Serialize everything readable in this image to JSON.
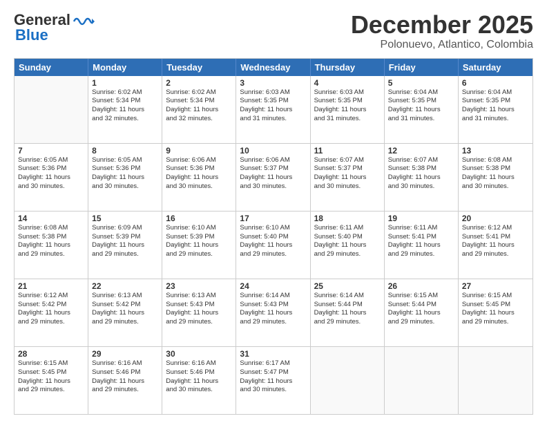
{
  "logo": {
    "line1": "General",
    "line2": "Blue"
  },
  "title": "December 2025",
  "subtitle": "Polonuevo, Atlantico, Colombia",
  "weekdays": [
    "Sunday",
    "Monday",
    "Tuesday",
    "Wednesday",
    "Thursday",
    "Friday",
    "Saturday"
  ],
  "rows": [
    [
      {
        "day": "",
        "info": ""
      },
      {
        "day": "1",
        "info": "Sunrise: 6:02 AM\nSunset: 5:34 PM\nDaylight: 11 hours\nand 32 minutes."
      },
      {
        "day": "2",
        "info": "Sunrise: 6:02 AM\nSunset: 5:34 PM\nDaylight: 11 hours\nand 32 minutes."
      },
      {
        "day": "3",
        "info": "Sunrise: 6:03 AM\nSunset: 5:35 PM\nDaylight: 11 hours\nand 31 minutes."
      },
      {
        "day": "4",
        "info": "Sunrise: 6:03 AM\nSunset: 5:35 PM\nDaylight: 11 hours\nand 31 minutes."
      },
      {
        "day": "5",
        "info": "Sunrise: 6:04 AM\nSunset: 5:35 PM\nDaylight: 11 hours\nand 31 minutes."
      },
      {
        "day": "6",
        "info": "Sunrise: 6:04 AM\nSunset: 5:35 PM\nDaylight: 11 hours\nand 31 minutes."
      }
    ],
    [
      {
        "day": "7",
        "info": "Sunrise: 6:05 AM\nSunset: 5:36 PM\nDaylight: 11 hours\nand 30 minutes."
      },
      {
        "day": "8",
        "info": "Sunrise: 6:05 AM\nSunset: 5:36 PM\nDaylight: 11 hours\nand 30 minutes."
      },
      {
        "day": "9",
        "info": "Sunrise: 6:06 AM\nSunset: 5:36 PM\nDaylight: 11 hours\nand 30 minutes."
      },
      {
        "day": "10",
        "info": "Sunrise: 6:06 AM\nSunset: 5:37 PM\nDaylight: 11 hours\nand 30 minutes."
      },
      {
        "day": "11",
        "info": "Sunrise: 6:07 AM\nSunset: 5:37 PM\nDaylight: 11 hours\nand 30 minutes."
      },
      {
        "day": "12",
        "info": "Sunrise: 6:07 AM\nSunset: 5:38 PM\nDaylight: 11 hours\nand 30 minutes."
      },
      {
        "day": "13",
        "info": "Sunrise: 6:08 AM\nSunset: 5:38 PM\nDaylight: 11 hours\nand 30 minutes."
      }
    ],
    [
      {
        "day": "14",
        "info": "Sunrise: 6:08 AM\nSunset: 5:38 PM\nDaylight: 11 hours\nand 29 minutes."
      },
      {
        "day": "15",
        "info": "Sunrise: 6:09 AM\nSunset: 5:39 PM\nDaylight: 11 hours\nand 29 minutes."
      },
      {
        "day": "16",
        "info": "Sunrise: 6:10 AM\nSunset: 5:39 PM\nDaylight: 11 hours\nand 29 minutes."
      },
      {
        "day": "17",
        "info": "Sunrise: 6:10 AM\nSunset: 5:40 PM\nDaylight: 11 hours\nand 29 minutes."
      },
      {
        "day": "18",
        "info": "Sunrise: 6:11 AM\nSunset: 5:40 PM\nDaylight: 11 hours\nand 29 minutes."
      },
      {
        "day": "19",
        "info": "Sunrise: 6:11 AM\nSunset: 5:41 PM\nDaylight: 11 hours\nand 29 minutes."
      },
      {
        "day": "20",
        "info": "Sunrise: 6:12 AM\nSunset: 5:41 PM\nDaylight: 11 hours\nand 29 minutes."
      }
    ],
    [
      {
        "day": "21",
        "info": "Sunrise: 6:12 AM\nSunset: 5:42 PM\nDaylight: 11 hours\nand 29 minutes."
      },
      {
        "day": "22",
        "info": "Sunrise: 6:13 AM\nSunset: 5:42 PM\nDaylight: 11 hours\nand 29 minutes."
      },
      {
        "day": "23",
        "info": "Sunrise: 6:13 AM\nSunset: 5:43 PM\nDaylight: 11 hours\nand 29 minutes."
      },
      {
        "day": "24",
        "info": "Sunrise: 6:14 AM\nSunset: 5:43 PM\nDaylight: 11 hours\nand 29 minutes."
      },
      {
        "day": "25",
        "info": "Sunrise: 6:14 AM\nSunset: 5:44 PM\nDaylight: 11 hours\nand 29 minutes."
      },
      {
        "day": "26",
        "info": "Sunrise: 6:15 AM\nSunset: 5:44 PM\nDaylight: 11 hours\nand 29 minutes."
      },
      {
        "day": "27",
        "info": "Sunrise: 6:15 AM\nSunset: 5:45 PM\nDaylight: 11 hours\nand 29 minutes."
      }
    ],
    [
      {
        "day": "28",
        "info": "Sunrise: 6:15 AM\nSunset: 5:45 PM\nDaylight: 11 hours\nand 29 minutes."
      },
      {
        "day": "29",
        "info": "Sunrise: 6:16 AM\nSunset: 5:46 PM\nDaylight: 11 hours\nand 29 minutes."
      },
      {
        "day": "30",
        "info": "Sunrise: 6:16 AM\nSunset: 5:46 PM\nDaylight: 11 hours\nand 30 minutes."
      },
      {
        "day": "31",
        "info": "Sunrise: 6:17 AM\nSunset: 5:47 PM\nDaylight: 11 hours\nand 30 minutes."
      },
      {
        "day": "",
        "info": ""
      },
      {
        "day": "",
        "info": ""
      },
      {
        "day": "",
        "info": ""
      }
    ]
  ]
}
